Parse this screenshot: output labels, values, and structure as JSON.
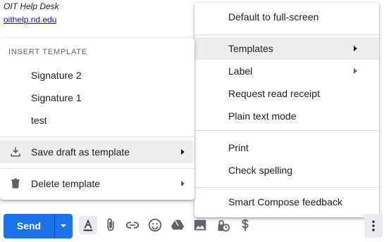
{
  "signature": {
    "name": "OIT Help Desk",
    "link": "oithelp.nd.edu"
  },
  "template_menu": {
    "section_title": "INSERT TEMPLATE",
    "templates": [
      "Signature 2",
      "Signature 1",
      "test"
    ],
    "save_draft_label": "Save draft as template",
    "delete_label": "Delete template",
    "save_icon": "download-icon",
    "delete_icon": "trash-icon"
  },
  "more_options_menu": {
    "default_fullscreen": "Default to full-screen",
    "templates": "Templates",
    "label": "Label",
    "read_receipt": "Request read receipt",
    "plain_text": "Plain text mode",
    "print": "Print",
    "check_spelling": "Check spelling",
    "smart_compose_feedback": "Smart Compose feedback"
  },
  "toolbar": {
    "send_label": "Send",
    "icons": [
      "format-text-icon",
      "attach-icon",
      "link-icon",
      "emoji-icon",
      "drive-icon",
      "photo-icon",
      "confidential-icon",
      "dollar-icon",
      "more-vert-icon"
    ]
  },
  "colors": {
    "accent": "#1a73e8",
    "highlight": "#eeeeee",
    "link": "#1a0dab"
  }
}
